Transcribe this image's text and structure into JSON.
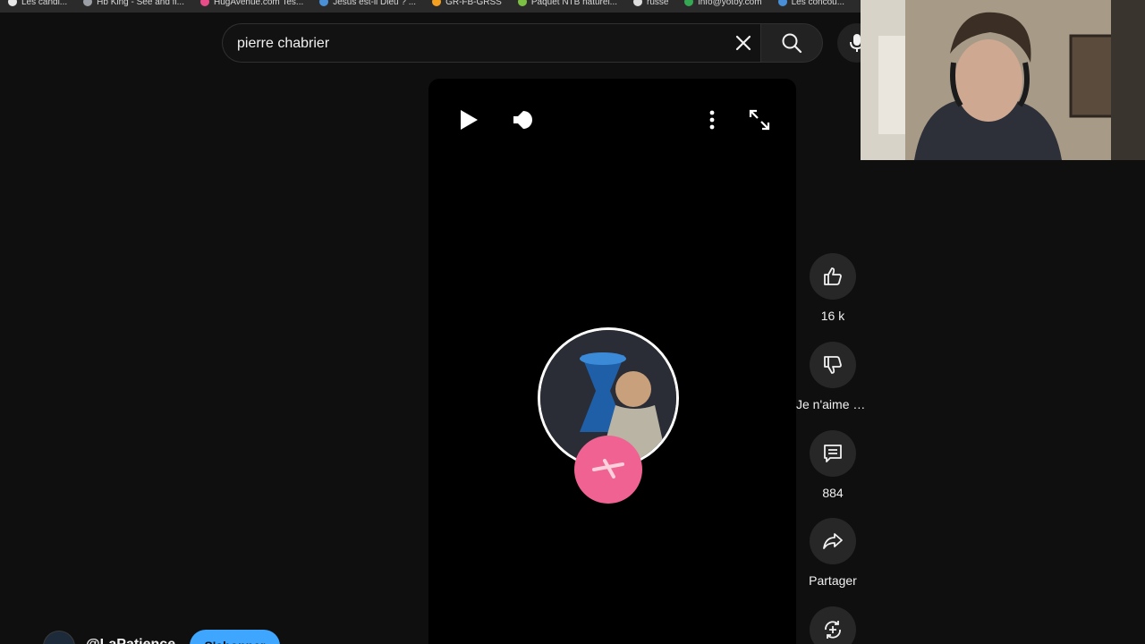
{
  "bookmarks": [
    {
      "label": "Les candi...",
      "color": "#e8e8e8"
    },
    {
      "label": "Hb King - See and fi...",
      "color": "#9aa0a6"
    },
    {
      "label": "HugAvenue.com Tes...",
      "color": "#e84d8a"
    },
    {
      "label": "Jésus est-il Dieu ? ...",
      "color": "#4a90d9"
    },
    {
      "label": "GR-FB-GRSS",
      "color": "#f4a020"
    },
    {
      "label": "Paquet NTB naturel...",
      "color": "#7bc043"
    },
    {
      "label": "russe",
      "color": "#dddddd"
    },
    {
      "label": "info@yotoy.com",
      "color": "#34a853"
    },
    {
      "label": "Les concou...",
      "color": "#4a90d9"
    }
  ],
  "search": {
    "query": "pierre chabrier"
  },
  "player": {
    "icons": [
      "play-icon",
      "volume-icon",
      "more-vert-icon",
      "fullscreen-icon"
    ]
  },
  "actions": {
    "like_count": "16 k",
    "dislike_label": "Je n'aime pas",
    "comment_count": "884",
    "share_label": "Partager"
  },
  "channel": {
    "handle": "@LaPatience",
    "subscribe_label": "S'abonner"
  },
  "colors": {
    "accent": "#3ea6ff",
    "background": "#0f0f0f",
    "button": "#272727",
    "badge_pink": "#f06292"
  }
}
